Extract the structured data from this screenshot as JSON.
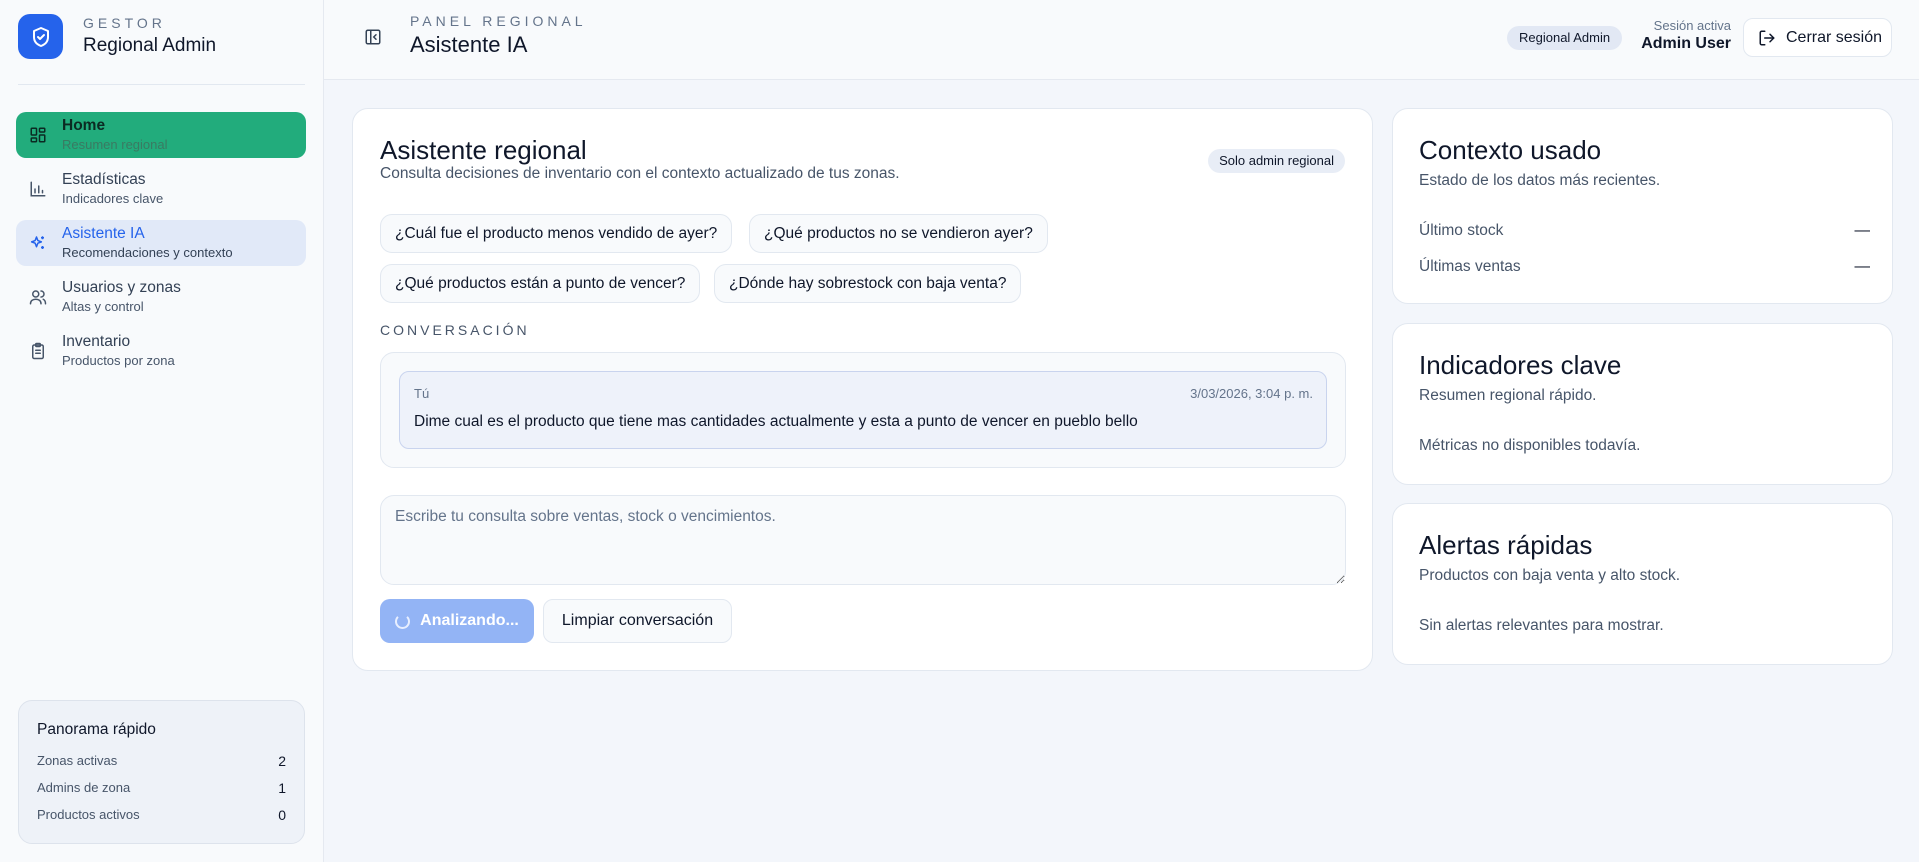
{
  "brand": {
    "sup": "GESTOR",
    "title": "Regional Admin"
  },
  "nav": {
    "items": [
      {
        "title": "Home",
        "sub": "Resumen regional"
      },
      {
        "title": "Estadísticas",
        "sub": "Indicadores clave"
      },
      {
        "title": "Asistente IA",
        "sub": "Recomendaciones y contexto"
      },
      {
        "title": "Usuarios y zonas",
        "sub": "Altas y control"
      },
      {
        "title": "Inventario",
        "sub": "Productos por zona"
      }
    ]
  },
  "panorama": {
    "title": "Panorama rápido",
    "rows": [
      {
        "label": "Zonas activas",
        "value": "2"
      },
      {
        "label": "Admins de zona",
        "value": "1"
      },
      {
        "label": "Productos activos",
        "value": "0"
      }
    ]
  },
  "header": {
    "sup": "PANEL REGIONAL",
    "title": "Asistente IA",
    "role_badge": "Regional Admin",
    "session_label": "Sesión activa",
    "session_user": "Admin User",
    "logout_label": "Cerrar sesión"
  },
  "chat": {
    "title": "Asistente regional",
    "subtitle": "Consulta decisiones de inventario con el contexto actualizado de tus zonas.",
    "badge": "Solo admin regional",
    "suggestions": [
      "¿Cuál fue el producto menos vendido de ayer?",
      "¿Qué productos no se vendieron ayer?",
      "¿Qué productos están a punto de vencer?",
      "¿Dónde hay sobrestock con baja venta?"
    ],
    "conversation_label": "CONVERSACIÓN",
    "message": {
      "author": "Tú",
      "time": "3/03/2026, 3:04 p. m.",
      "text": "Dime cual es el producto que tiene mas cantidades actualmente y esta a punto de vencer en pueblo bello"
    },
    "input_placeholder": "Escribe tu consulta sobre ventas, stock o vencimientos.",
    "analyze_label": "Analizando...",
    "clear_label": "Limpiar conversación"
  },
  "context": {
    "title": "Contexto usado",
    "subtitle": "Estado de los datos más recientes.",
    "rows": [
      {
        "label": "Último stock",
        "value": "—"
      },
      {
        "label": "Últimas ventas",
        "value": "—"
      }
    ]
  },
  "indicators": {
    "title": "Indicadores clave",
    "subtitle": "Resumen regional rápido.",
    "note": "Métricas no disponibles todavía."
  },
  "alerts": {
    "title": "Alertas rápidas",
    "subtitle": "Productos con baja venta y alto stock.",
    "note": "Sin alertas relevantes para mostrar."
  },
  "colors": {
    "accent": "#2563eb",
    "home_active": "#22ac7c",
    "analyze_button": "#93b4f5"
  }
}
